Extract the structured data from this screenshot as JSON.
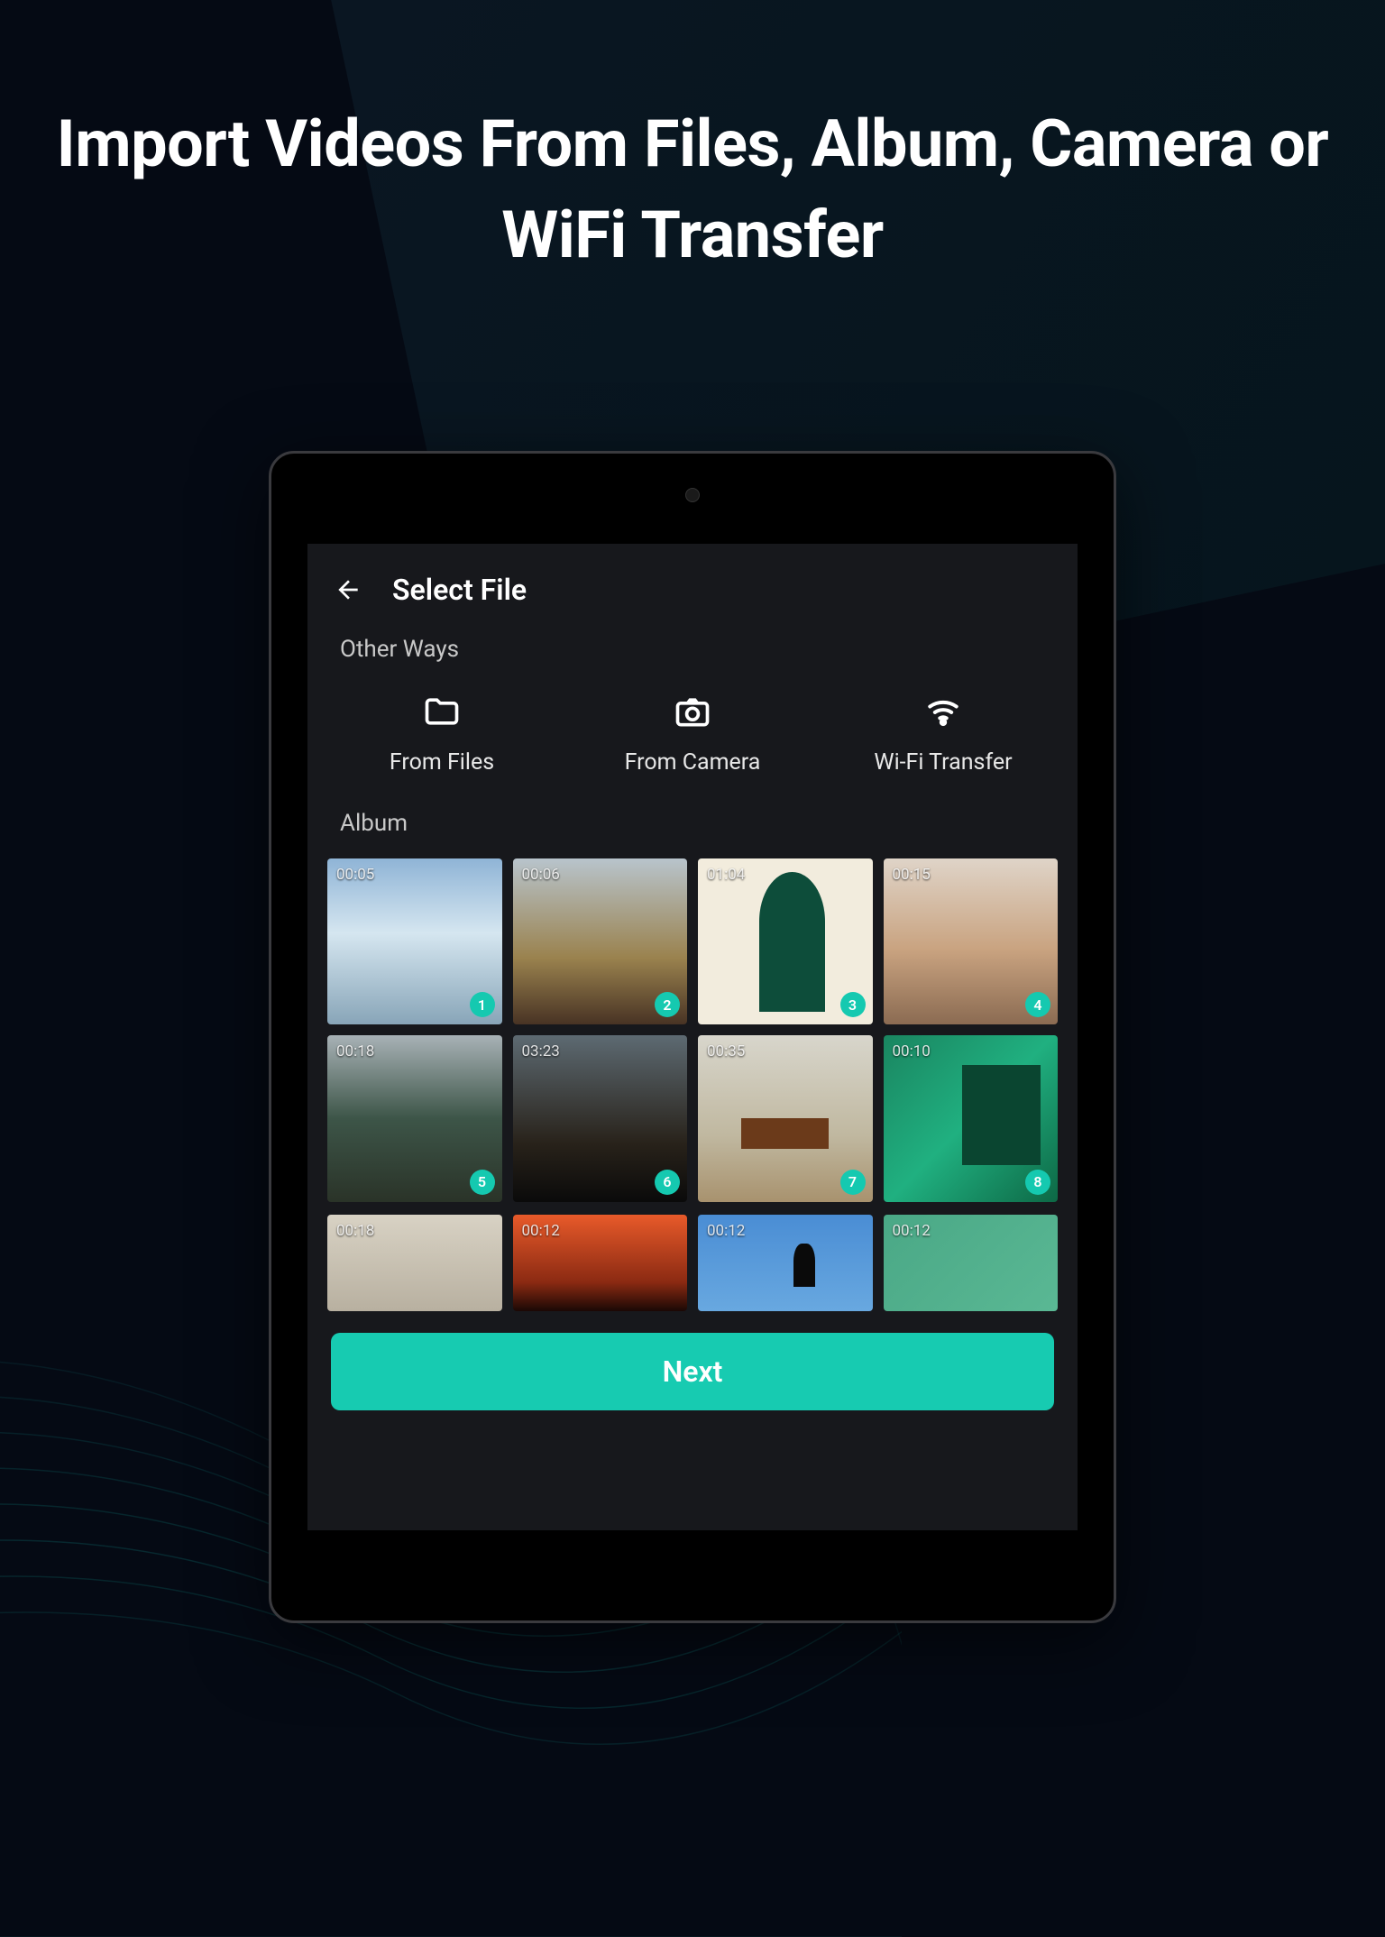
{
  "headline": "Import Videos From Files, Album, Camera or WiFi Transfer",
  "page_title": "Select File",
  "section_other_ways": "Other Ways",
  "options": {
    "files": "From Files",
    "camera": "From Camera",
    "wifi": "Wi-Fi Transfer"
  },
  "section_album": "Album",
  "thumbs": [
    {
      "duration": "00:05",
      "badge": "1"
    },
    {
      "duration": "00:06",
      "badge": "2"
    },
    {
      "duration": "01:04",
      "badge": "3"
    },
    {
      "duration": "00:15",
      "badge": "4"
    },
    {
      "duration": "00:18",
      "badge": "5"
    },
    {
      "duration": "03:23",
      "badge": "6"
    },
    {
      "duration": "00:35",
      "badge": "7"
    },
    {
      "duration": "00:10",
      "badge": "8"
    },
    {
      "duration": "00:18",
      "badge": ""
    },
    {
      "duration": "00:12",
      "badge": ""
    },
    {
      "duration": "00:12",
      "badge": ""
    },
    {
      "duration": "00:12",
      "badge": ""
    }
  ],
  "next_button": "Next",
  "colors": {
    "accent": "#17cbb1",
    "background": "#050a14",
    "screen": "#17181c"
  }
}
